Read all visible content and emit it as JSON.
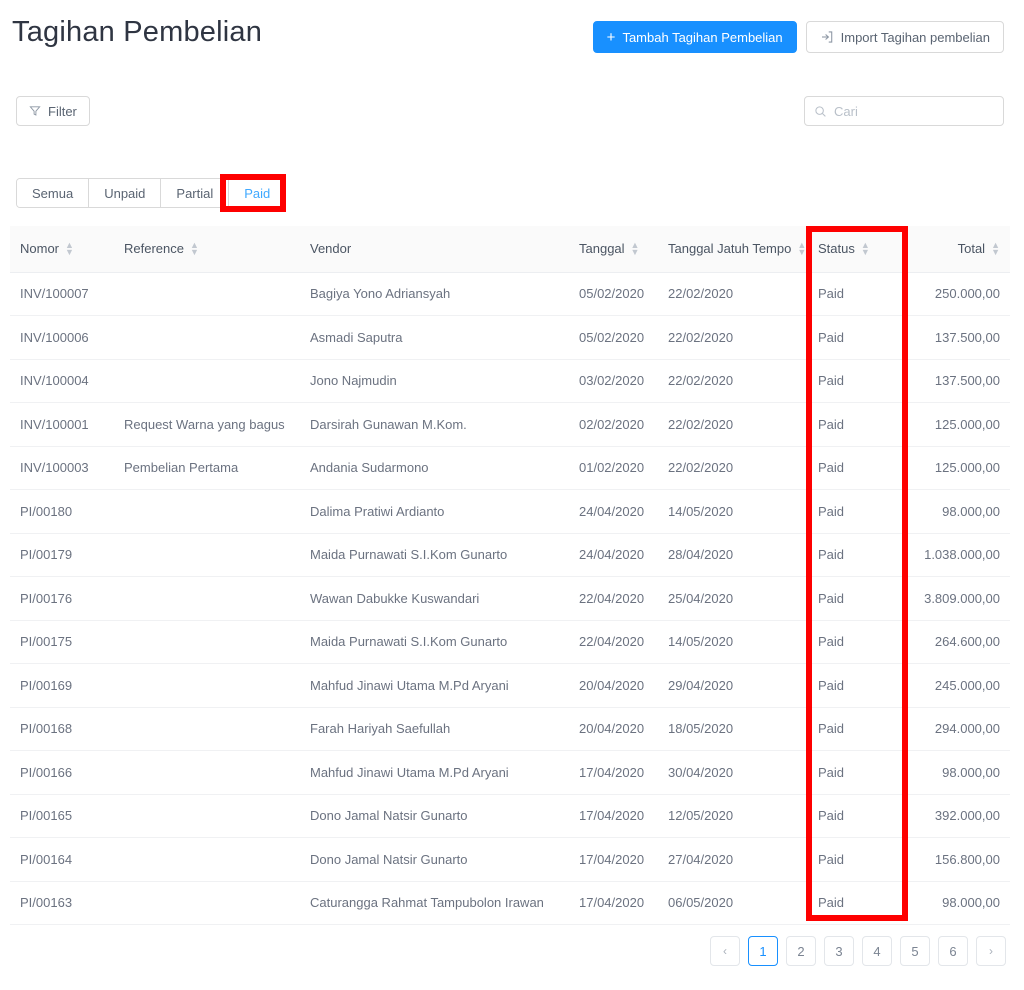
{
  "header": {
    "title": "Tagihan Pembelian",
    "add_button": {
      "label": "Tambah Tagihan Pembelian",
      "icon": "plus-icon"
    },
    "import_button": {
      "label": "Import Tagihan pembelian",
      "icon": "import-icon"
    },
    "primary_color": "#1890ff"
  },
  "toolbar": {
    "filter_label": "Filter",
    "filter_icon": "funnel-icon",
    "search": {
      "value": "",
      "placeholder": "Cari",
      "icon": "search-icon"
    }
  },
  "tabs": {
    "items": [
      {
        "label": "Semua",
        "active": false
      },
      {
        "label": "Unpaid",
        "active": false
      },
      {
        "label": "Partial",
        "active": false
      },
      {
        "label": "Paid",
        "active": true
      }
    ],
    "active_label": "Paid"
  },
  "table": {
    "columns": [
      {
        "key": "nomor",
        "label": "Nomor",
        "sortable": true,
        "align": "left"
      },
      {
        "key": "ref",
        "label": "Reference",
        "sortable": true,
        "align": "left"
      },
      {
        "key": "vendor",
        "label": "Vendor",
        "sortable": false,
        "align": "left"
      },
      {
        "key": "tgl",
        "label": "Tanggal",
        "sortable": true,
        "align": "left"
      },
      {
        "key": "due",
        "label": "Tanggal Jatuh Tempo",
        "sortable": true,
        "align": "left"
      },
      {
        "key": "status",
        "label": "Status",
        "sortable": true,
        "align": "left"
      },
      {
        "key": "total",
        "label": "Total",
        "sortable": true,
        "align": "right"
      }
    ],
    "rows": [
      {
        "nomor": "INV/100007",
        "ref": "",
        "vendor": "Bagiya Yono Adriansyah",
        "tgl": "05/02/2020",
        "due": "22/02/2020",
        "status": "Paid",
        "total": "250.000,00"
      },
      {
        "nomor": "INV/100006",
        "ref": "",
        "vendor": "Asmadi Saputra",
        "tgl": "05/02/2020",
        "due": "22/02/2020",
        "status": "Paid",
        "total": "137.500,00"
      },
      {
        "nomor": "INV/100004",
        "ref": "",
        "vendor": "Jono Najmudin",
        "tgl": "03/02/2020",
        "due": "22/02/2020",
        "status": "Paid",
        "total": "137.500,00"
      },
      {
        "nomor": "INV/100001",
        "ref": "Request Warna yang bagus",
        "vendor": "Darsirah Gunawan M.Kom.",
        "tgl": "02/02/2020",
        "due": "22/02/2020",
        "status": "Paid",
        "total": "125.000,00"
      },
      {
        "nomor": "INV/100003",
        "ref": "Pembelian Pertama",
        "vendor": "Andania Sudarmono",
        "tgl": "01/02/2020",
        "due": "22/02/2020",
        "status": "Paid",
        "total": "125.000,00"
      },
      {
        "nomor": "PI/00180",
        "ref": "",
        "vendor": "Dalima Pratiwi Ardianto",
        "tgl": "24/04/2020",
        "due": "14/05/2020",
        "status": "Paid",
        "total": "98.000,00"
      },
      {
        "nomor": "PI/00179",
        "ref": "",
        "vendor": "Maida Purnawati S.I.Kom Gunarto",
        "tgl": "24/04/2020",
        "due": "28/04/2020",
        "status": "Paid",
        "total": "1.038.000,00"
      },
      {
        "nomor": "PI/00176",
        "ref": "",
        "vendor": "Wawan Dabukke Kuswandari",
        "tgl": "22/04/2020",
        "due": "25/04/2020",
        "status": "Paid",
        "total": "3.809.000,00"
      },
      {
        "nomor": "PI/00175",
        "ref": "",
        "vendor": "Maida Purnawati S.I.Kom Gunarto",
        "tgl": "22/04/2020",
        "due": "14/05/2020",
        "status": "Paid",
        "total": "264.600,00"
      },
      {
        "nomor": "PI/00169",
        "ref": "",
        "vendor": "Mahfud Jinawi Utama M.Pd Aryani",
        "tgl": "20/04/2020",
        "due": "29/04/2020",
        "status": "Paid",
        "total": "245.000,00"
      },
      {
        "nomor": "PI/00168",
        "ref": "",
        "vendor": "Farah Hariyah Saefullah",
        "tgl": "20/04/2020",
        "due": "18/05/2020",
        "status": "Paid",
        "total": "294.000,00"
      },
      {
        "nomor": "PI/00166",
        "ref": "",
        "vendor": "Mahfud Jinawi Utama M.Pd Aryani",
        "tgl": "17/04/2020",
        "due": "30/04/2020",
        "status": "Paid",
        "total": "98.000,00"
      },
      {
        "nomor": "PI/00165",
        "ref": "",
        "vendor": "Dono Jamal Natsir Gunarto",
        "tgl": "17/04/2020",
        "due": "12/05/2020",
        "status": "Paid",
        "total": "392.000,00"
      },
      {
        "nomor": "PI/00164",
        "ref": "",
        "vendor": "Dono Jamal Natsir Gunarto",
        "tgl": "17/04/2020",
        "due": "27/04/2020",
        "status": "Paid",
        "total": "156.800,00"
      },
      {
        "nomor": "PI/00163",
        "ref": "",
        "vendor": "Caturangga Rahmat Tampubolon Irawan",
        "tgl": "17/04/2020",
        "due": "06/05/2020",
        "status": "Paid",
        "total": "98.000,00"
      }
    ],
    "status_color": "#52c41a",
    "link_color": "#4a90e2"
  },
  "pagination": {
    "prev_label": "‹",
    "next_label": "›",
    "pages": [
      "1",
      "2",
      "3",
      "4",
      "5",
      "6"
    ],
    "current": "1"
  },
  "annotations": {
    "color": "#fe0000",
    "boxes": [
      {
        "name": "paid-tab-highlight",
        "target": "Paid"
      },
      {
        "name": "status-column-highlight",
        "target": "Status"
      }
    ]
  }
}
